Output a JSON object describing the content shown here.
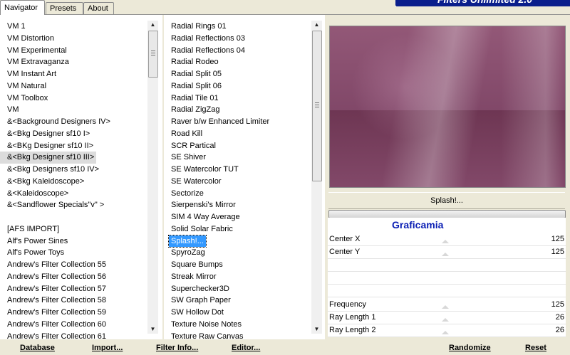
{
  "tabs": [
    {
      "label": "Navigator",
      "active": true
    },
    {
      "label": "Presets"
    },
    {
      "label": "About"
    }
  ],
  "brand": "Filters Unlimited 2.0",
  "categories": [
    "VM 1",
    "VM Distortion",
    "VM Experimental",
    "VM Extravaganza",
    "VM Instant Art",
    "VM Natural",
    "VM Toolbox",
    "VM",
    "&<Background Designers IV>",
    "&<Bkg Designer sf10 I>",
    "&<BKg Designer sf10 II>",
    "&<Bkg Designer sf10 III>",
    "&<Bkg Designers sf10 IV>",
    "&<Bkg Kaleidoscope>",
    "&<Kaleidoscope>",
    "&<Sandflower Specials\"v\" >",
    "",
    "[AFS IMPORT]",
    "Alf's Power Sines",
    "Alf's Power Toys",
    "Andrew's Filter Collection 55",
    "Andrew's Filter Collection 56",
    "Andrew's Filter Collection 57",
    "Andrew's Filter Collection 58",
    "Andrew's Filter Collection 59",
    "Andrew's Filter Collection 60",
    "Andrew's Filter Collection 61"
  ],
  "selected_category": "&<Bkg Designer sf10 III>",
  "filters": [
    "Radial  Rings 01",
    "Radial Reflections 03",
    "Radial Reflections 04",
    "Radial Rodeo",
    "Radial Split 05",
    "Radial Split 06",
    "Radial Tile 01",
    "Radial ZigZag",
    "Raver b/w Enhanced Limiter",
    "Road Kill",
    "SCR  Partical",
    "SE Shiver",
    "SE Watercolor TUT",
    "SE Watercolor",
    "Sectorize",
    "Sierpenski's Mirror",
    "SIM 4 Way Average",
    "Solid Solar Fabric",
    "Splash!...",
    "SpyroZag",
    "Square Bumps",
    "Streak Mirror",
    "Superchecker3D",
    "SW Graph Paper",
    "SW Hollow Dot",
    "Texture Noise Notes",
    "Texture Raw Canvas"
  ],
  "selected_filter": "Splash!...",
  "current_filter_label": "Splash!...",
  "logo_text": "Graficamia",
  "params": [
    {
      "label": "Center X",
      "value": "125"
    },
    {
      "label": "Center Y",
      "value": "125"
    },
    {
      "label": "",
      "value": ""
    },
    {
      "label": "",
      "value": ""
    },
    {
      "label": "",
      "value": ""
    },
    {
      "label": "Frequency",
      "value": "125"
    },
    {
      "label": "Ray Length 1",
      "value": "26"
    },
    {
      "label": "Ray Length 2",
      "value": "26"
    }
  ],
  "buttons": {
    "database": "Database",
    "import": "Import...",
    "filter_info": "Filter Info...",
    "editor": "Editor...",
    "randomize": "Randomize",
    "reset": "Reset"
  },
  "colors": {
    "preview_base": "#82496a",
    "selection": "#3399ff",
    "logo": "#0a1eb4"
  }
}
